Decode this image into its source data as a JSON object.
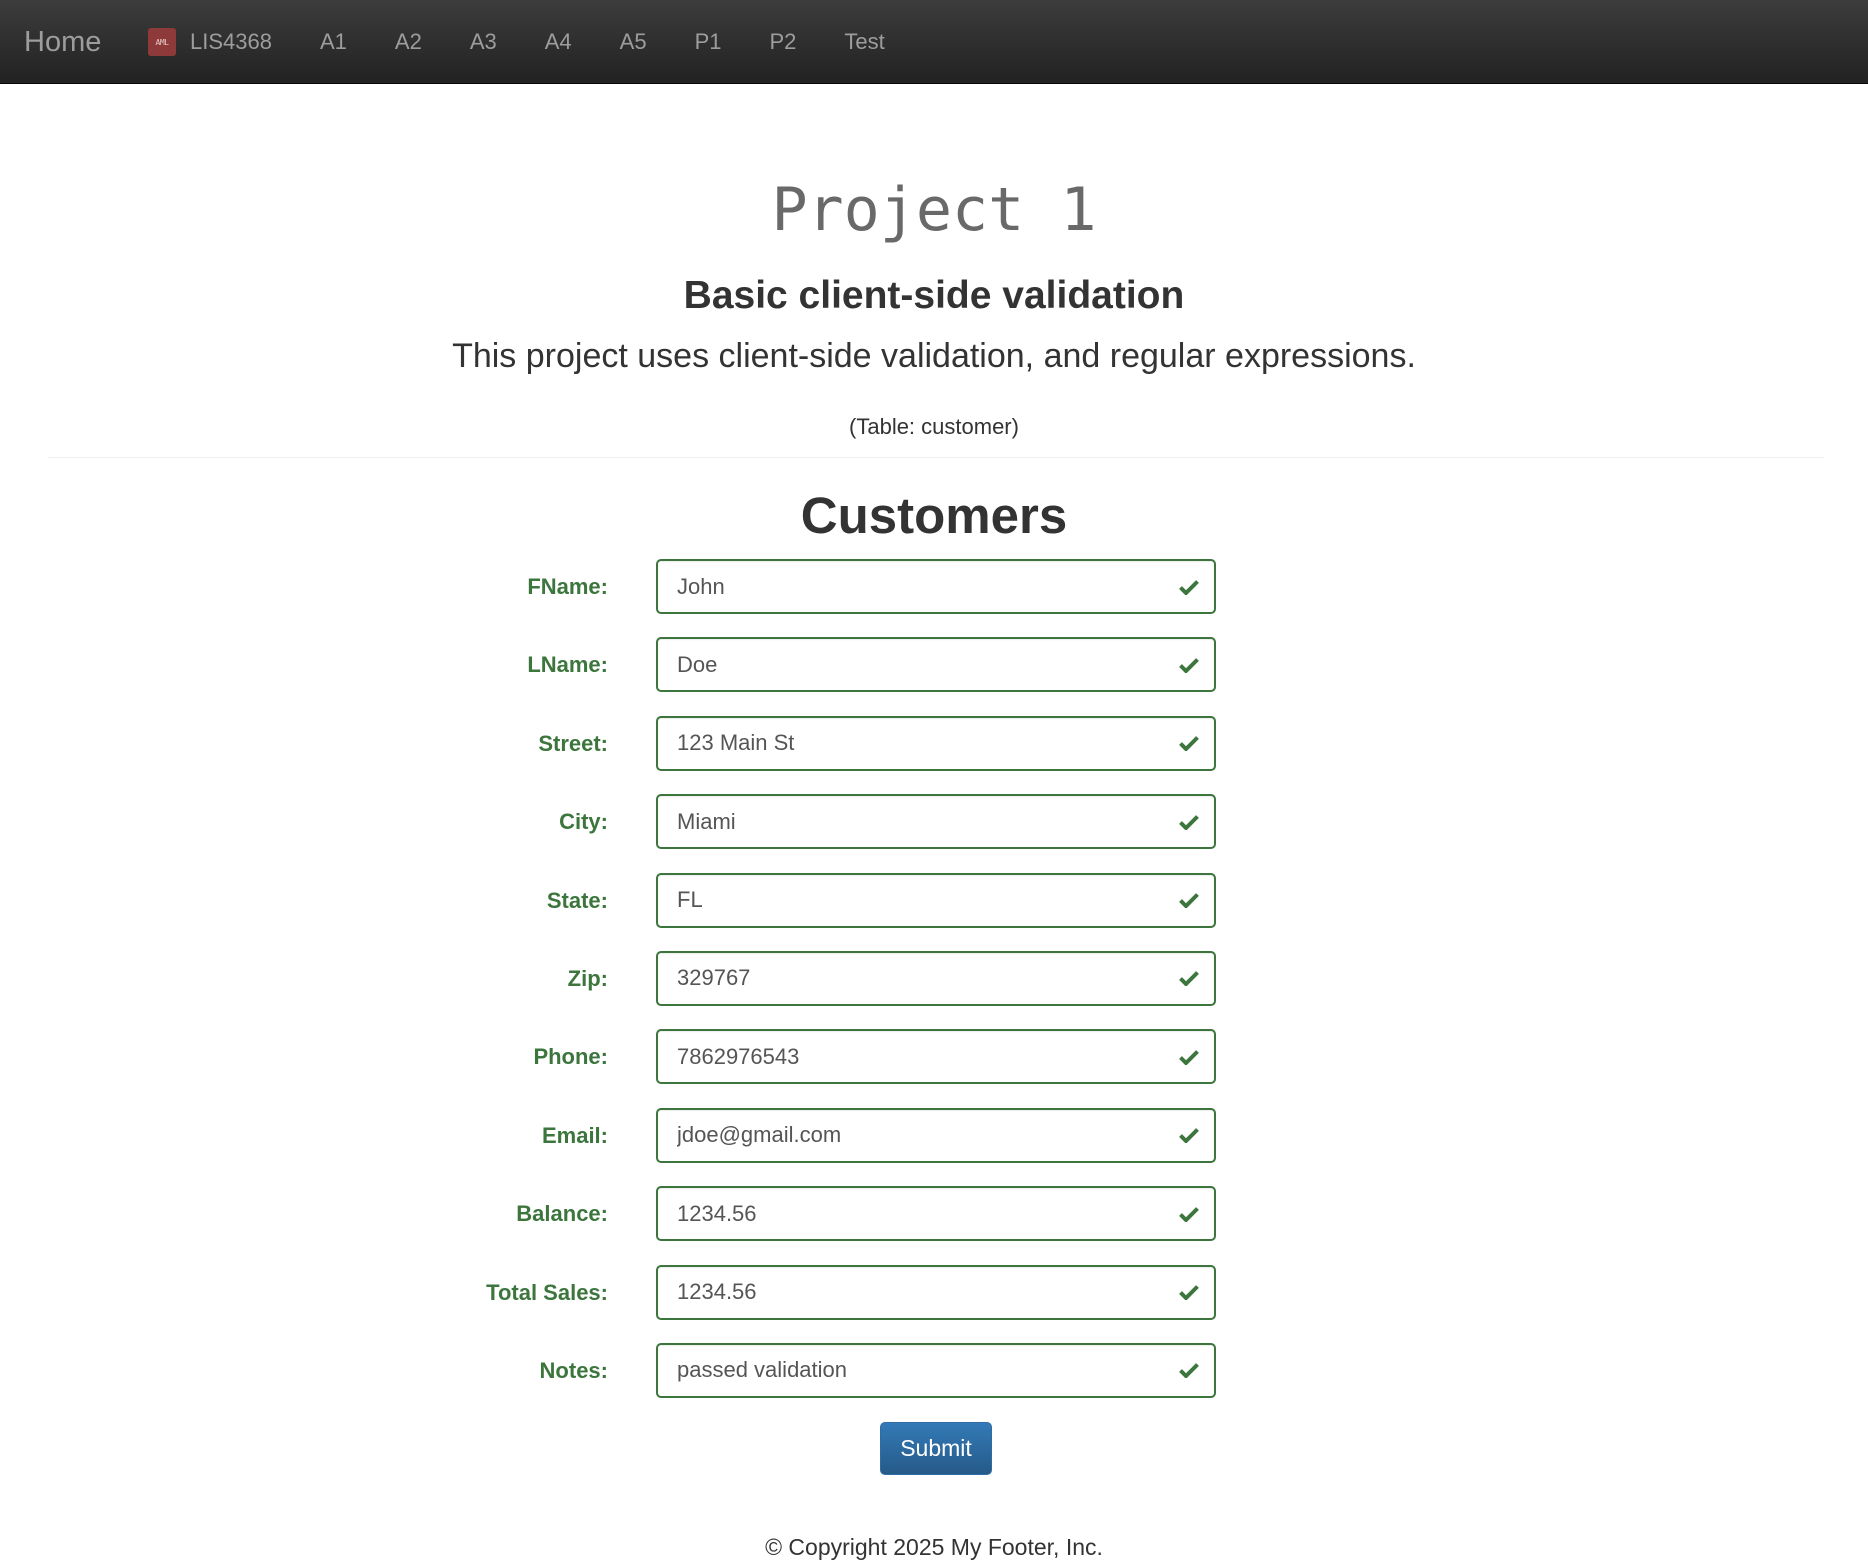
{
  "navbar": {
    "brand": "Home",
    "logo_text": "AML",
    "items": [
      {
        "label": "LIS4368",
        "has_logo": true
      },
      {
        "label": "A1"
      },
      {
        "label": "A2"
      },
      {
        "label": "A3"
      },
      {
        "label": "A4"
      },
      {
        "label": "A5"
      },
      {
        "label": "P1"
      },
      {
        "label": "P2"
      },
      {
        "label": "Test"
      }
    ]
  },
  "header": {
    "title": "Project 1",
    "subtitle": "Basic client-side validation",
    "lead": "This project uses client-side validation, and regular expressions.",
    "table_note": "(Table: customer)"
  },
  "form": {
    "heading": "Customers",
    "fields": [
      {
        "label": "FName:",
        "value": "John"
      },
      {
        "label": "LName:",
        "value": "Doe"
      },
      {
        "label": "Street:",
        "value": "123 Main St"
      },
      {
        "label": "City:",
        "value": "Miami"
      },
      {
        "label": "State:",
        "value": "FL"
      },
      {
        "label": "Zip:",
        "value": "329767"
      },
      {
        "label": "Phone:",
        "value": "7862976543"
      },
      {
        "label": "Email:",
        "value": "jdoe@gmail.com"
      },
      {
        "label": "Balance:",
        "value": "1234.56"
      },
      {
        "label": "Total Sales:",
        "value": "1234.56"
      },
      {
        "label": "Notes:",
        "value": "passed validation"
      }
    ],
    "submit_label": "Submit"
  },
  "footer": {
    "text": "© Copyright 2025 My Footer, Inc."
  },
  "colors": {
    "valid": "#3c763d",
    "navbar_bg": "#222222",
    "button_primary": "#337ab7"
  },
  "icons": {
    "field_status": "checkmark-icon"
  }
}
